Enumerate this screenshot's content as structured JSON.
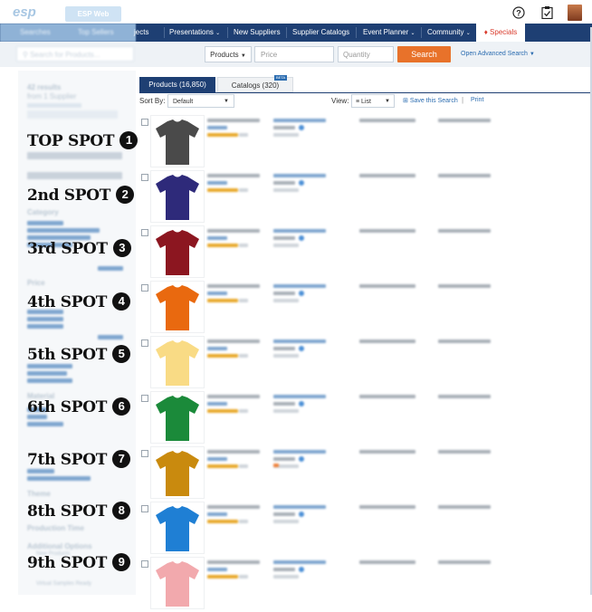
{
  "header": {
    "logo": "esp",
    "esp_web_tab": "ESP Web",
    "help_icon": "help-circle-icon",
    "tasks_icon": "clipboard-check-icon",
    "avatar": "user-avatar"
  },
  "nav": {
    "items_faded": [
      "Searches",
      "Top Sellers"
    ],
    "items": [
      "Projects",
      "Presentations",
      "New Suppliers",
      "Supplier Catalogs",
      "Event Planner",
      "Community"
    ],
    "partial_projects": "jects",
    "specials": "Specials"
  },
  "search": {
    "left_placeholder": "Search for Products...",
    "scope": "Products",
    "price_placeholder": "Price",
    "quantity_placeholder": "Quantity",
    "button": "Search",
    "advanced": "Open Advanced Search"
  },
  "sidebar": {
    "results": "42 results",
    "item_supplier": "from 1 Supplier",
    "sections": [
      "Category",
      "Price",
      "Material",
      "Theme",
      "Production Time",
      "Additional Options"
    ],
    "option_new_products": "New Products",
    "option_virtual_sample": "Virtual Samples Ready",
    "spots": [
      {
        "label": "TOP SPOT",
        "num": "1"
      },
      {
        "label": "2nd SPOT",
        "num": "2"
      },
      {
        "label": "3rd SPOT",
        "num": "3"
      },
      {
        "label": "4th SPOT",
        "num": "4"
      },
      {
        "label": "5th SPOT",
        "num": "5"
      },
      {
        "label": "6th SPOT",
        "num": "6"
      },
      {
        "label": "7th SPOT",
        "num": "7"
      },
      {
        "label": "8th SPOT",
        "num": "8"
      },
      {
        "label": "9th SPOT",
        "num": "9"
      }
    ]
  },
  "results": {
    "tab_products": "Products (16,850)",
    "tab_catalogs": "Catalogs (320)",
    "beta": "BETA",
    "sort_by_label": "Sort By:",
    "sort_value": "Default",
    "view_label": "View:",
    "view_value": "List",
    "save_search": "Save this Search",
    "print": "Print"
  },
  "colors": {
    "nav_bg": "#1e3f73",
    "accent_orange": "#e8722a",
    "specials_red": "#d93a2b",
    "shirts": [
      "#4a4a4a",
      "#2e2a7a",
      "#8c1620",
      "#e9690f",
      "#f9db85",
      "#1b8a3a",
      "#c98a0e",
      "#1f7fd4",
      "#f2a9ad"
    ]
  }
}
